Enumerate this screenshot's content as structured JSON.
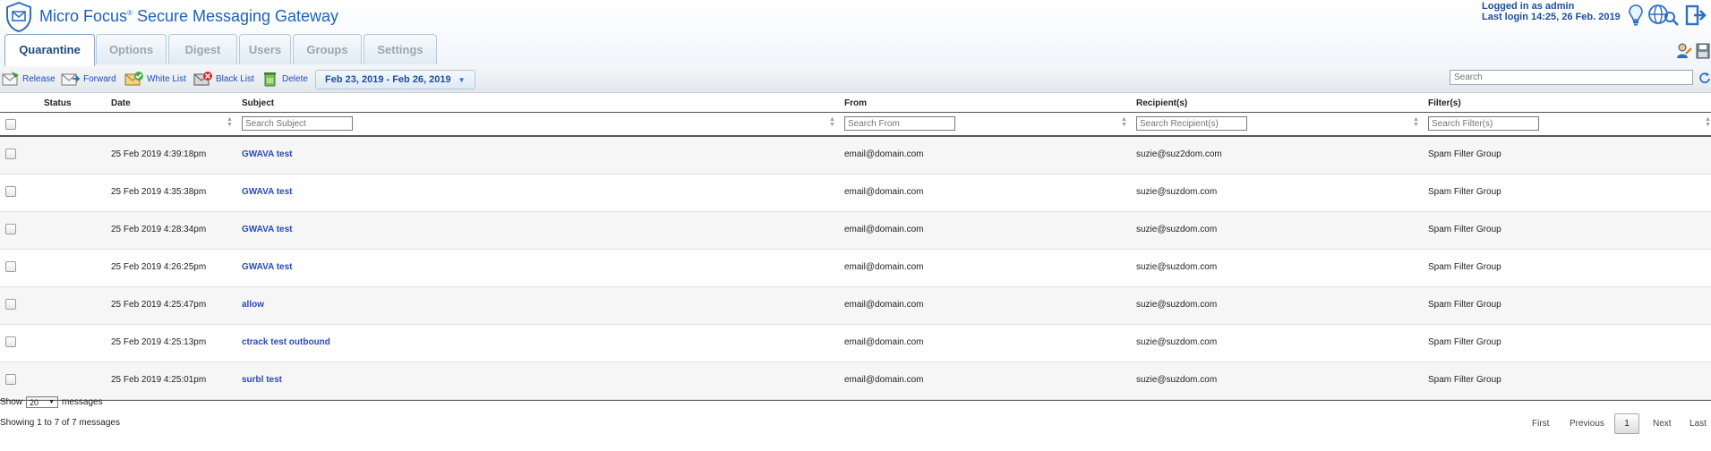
{
  "header": {
    "app_title": "Micro Focus",
    "app_title_rest": "Secure Messaging Gateway",
    "trademark": "®",
    "login_line1": "Logged in as admin",
    "login_line2": "Last login 14:25, 26 Feb. 2019"
  },
  "tabs": [
    {
      "label": "Quarantine",
      "active": true
    },
    {
      "label": "Options"
    },
    {
      "label": "Digest"
    },
    {
      "label": "Users"
    },
    {
      "label": "Groups"
    },
    {
      "label": "Settings"
    }
  ],
  "toolbar": {
    "release": "Release",
    "forward": "Forward",
    "white_list": "White List",
    "black_list": "Black List",
    "delete": "Delete",
    "date_range": "Feb 23, 2019 - Feb 26, 2019",
    "search_placeholder": "Search"
  },
  "table": {
    "columns": {
      "status": "Status",
      "date": "Date",
      "subject": "Subject",
      "from": "From",
      "recipients": "Recipient(s)",
      "filters": "Filter(s)"
    },
    "filter_placeholders": {
      "subject": "Search Subject",
      "from": "Search From",
      "recipients": "Search Recipient(s)",
      "filters": "Search Filter(s)"
    },
    "rows": [
      {
        "date": "25 Feb 2019 4:39:18pm",
        "subject": "GWAVA test",
        "from": "email@domain.com",
        "recipient": "suzie@suz2dom.com",
        "filter": "Spam Filter Group"
      },
      {
        "date": "25 Feb 2019 4:35:38pm",
        "subject": "GWAVA test",
        "from": "email@domain.com",
        "recipient": "suzie@suzdom.com",
        "filter": "Spam Filter Group"
      },
      {
        "date": "25 Feb 2019 4:28:34pm",
        "subject": "GWAVA test",
        "from": "email@domain.com",
        "recipient": "suzie@suzdom.com",
        "filter": "Spam Filter Group"
      },
      {
        "date": "25 Feb 2019 4:26:25pm",
        "subject": "GWAVA test",
        "from": "email@domain.com",
        "recipient": "suzie@suzdom.com",
        "filter": "Spam Filter Group"
      },
      {
        "date": "25 Feb 2019 4:25:47pm",
        "subject": "allow",
        "from": "email@domain.com",
        "recipient": "suzie@suzdom.com",
        "filter": "Spam Filter Group"
      },
      {
        "date": "25 Feb 2019 4:25:13pm",
        "subject": "ctrack test outbound",
        "from": "email@domain.com",
        "recipient": "suzie@suzdom.com",
        "filter": "Spam Filter Group"
      },
      {
        "date": "25 Feb 2019 4:25:01pm",
        "subject": "surbl test",
        "from": "email@domain.com",
        "recipient": "suzie@suzdom.com",
        "filter": "Spam Filter Group"
      }
    ]
  },
  "footer": {
    "show_label": "Show",
    "page_size": "20",
    "messages_label": "messages",
    "showing_text": "Showing 1 to 7 of 7 messages",
    "first": "First",
    "previous": "Previous",
    "current_page": "1",
    "next": "Next",
    "last": "Last"
  },
  "colors": {
    "accent": "#1f63b6",
    "link": "#2a4bb5"
  },
  "icons": [
    "envelope-shield-icon",
    "lightbulb-icon",
    "globe-search-icon",
    "logout-icon",
    "user-settings-icon",
    "save-icon",
    "release-icon",
    "forward-icon",
    "white-list-icon",
    "black-list-icon",
    "delete-icon",
    "chevron-down-icon",
    "refresh-icon"
  ]
}
